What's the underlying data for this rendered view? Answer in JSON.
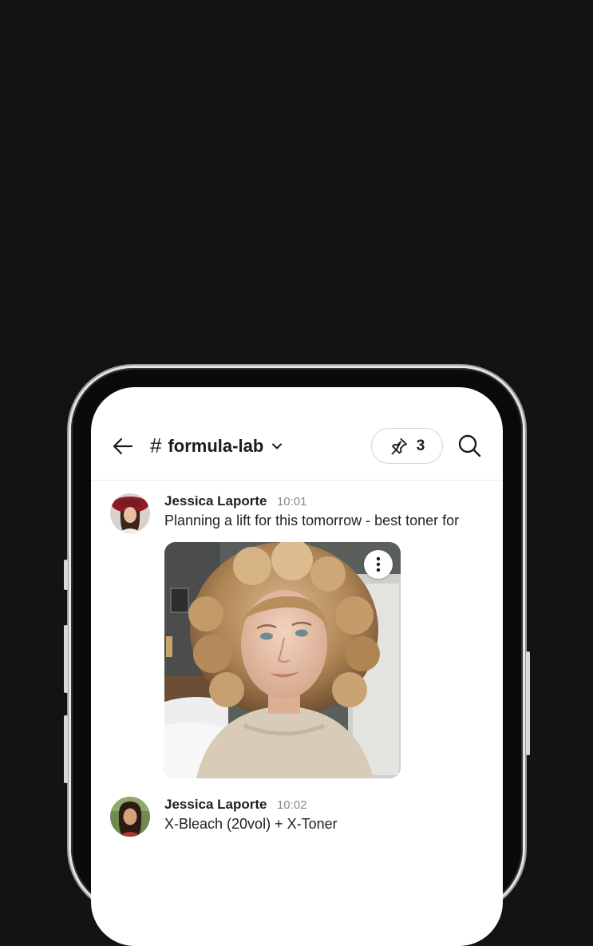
{
  "header": {
    "channel_name": "formula-lab",
    "pinned_count": "3"
  },
  "messages": [
    {
      "author": "Jessica Laporte",
      "time": "10:01",
      "text": "Planning a lift for this tomorrow - best toner for"
    },
    {
      "author": "Jessica Laporte",
      "time": "10:02",
      "text": "X-Bleach (20vol) + X-Toner"
    }
  ],
  "icons": {
    "back": "arrow-left-icon",
    "channel": "hash-icon",
    "dropdown": "chevron-down-icon",
    "pin": "pin-icon",
    "search": "search-icon",
    "more": "more-vertical-icon"
  },
  "colors": {
    "background": "#131313",
    "screen": "#ffffff",
    "text": "#1c1c1c",
    "muted": "#8a8a8a"
  }
}
